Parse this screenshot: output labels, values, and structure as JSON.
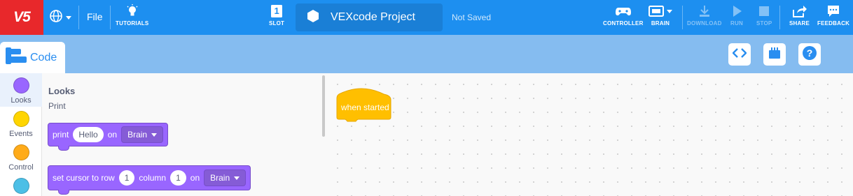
{
  "menubar": {
    "logo": "V5",
    "file": "File",
    "tutorials": "TUTORIALS",
    "slot_number": "1",
    "slot": "SLOT",
    "project_name": "VEXcode Project",
    "save_status": "Not Saved",
    "controller": "CONTROLLER",
    "brain": "BRAIN",
    "download": "DOWNLOAD",
    "run": "RUN",
    "stop": "STOP",
    "share": "SHARE",
    "feedback": "FEEDBACK"
  },
  "tabs": {
    "code": "Code"
  },
  "categories": [
    {
      "label": "Looks",
      "color": "#9966ff"
    },
    {
      "label": "Events",
      "color": "#ffd500"
    },
    {
      "label": "Control",
      "color": "#ffab19"
    },
    {
      "label": "",
      "color": "#4cbfe6"
    }
  ],
  "flyout": {
    "heading": "Looks",
    "subheading": "Print",
    "print_block": {
      "text": "print",
      "value": "Hello",
      "on": "on",
      "target": "Brain"
    },
    "cursor_block": {
      "text": "set cursor to row",
      "row": "1",
      "column_label": "column",
      "column": "1",
      "on": "on",
      "target": "Brain"
    }
  },
  "workspace": {
    "hat_block": "when started"
  },
  "colors": {
    "menubar": "#1d8ff0",
    "logo_bg": "#e8282b",
    "looks": "#9966ff",
    "events": "#ffd500",
    "control": "#ffab19",
    "tabbar": "#85bcf0"
  }
}
